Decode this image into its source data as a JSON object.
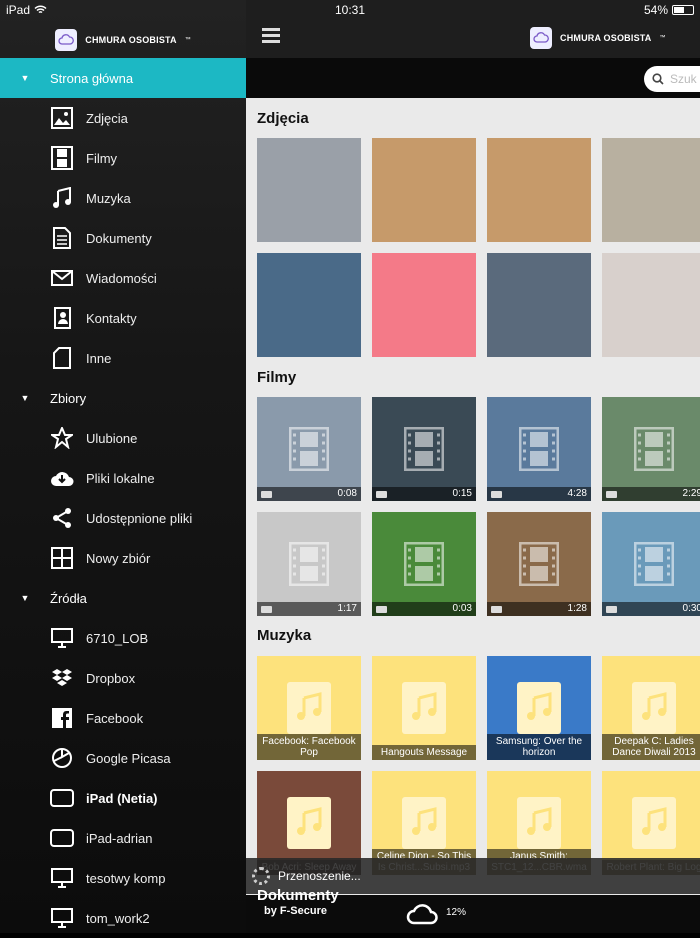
{
  "status": {
    "device": "iPad",
    "time": "10:31",
    "battery": "54%"
  },
  "app": {
    "logo_text": "CHMURA OSOBISTA",
    "tm": "™",
    "search_placeholder": "Szuk",
    "by": "by F-Secure",
    "upload_pct": "12%",
    "transfer_text": "Przenoszenie..."
  },
  "sidebar": {
    "sections": [
      {
        "label": "Strona główna"
      },
      {
        "label": "Zbiory"
      },
      {
        "label": "Źródła"
      }
    ],
    "home_items": [
      {
        "label": "Zdjęcia",
        "icon": "photo-icon"
      },
      {
        "label": "Filmy",
        "icon": "film-icon"
      },
      {
        "label": "Muzyka",
        "icon": "music-icon"
      },
      {
        "label": "Dokumenty",
        "icon": "document-icon"
      },
      {
        "label": "Wiadomości",
        "icon": "mail-icon"
      },
      {
        "label": "Kontakty",
        "icon": "contacts-icon"
      },
      {
        "label": "Inne",
        "icon": "file-icon"
      }
    ],
    "collections": [
      {
        "label": "Ulubione",
        "icon": "star-icon"
      },
      {
        "label": "Pliki lokalne",
        "icon": "download-cloud-icon"
      },
      {
        "label": "Udostępnione pliki",
        "icon": "share-icon"
      },
      {
        "label": "Nowy zbiór",
        "icon": "grid-icon"
      }
    ],
    "sources": [
      {
        "label": "6710_LOB",
        "icon": "monitor-icon"
      },
      {
        "label": "Dropbox",
        "icon": "dropbox-icon"
      },
      {
        "label": "Facebook",
        "icon": "facebook-icon"
      },
      {
        "label": "Google Picasa",
        "icon": "picasa-icon"
      },
      {
        "label": "iPad (Netia)",
        "icon": "tablet-icon"
      },
      {
        "label": "iPad-adrian",
        "icon": "tablet-icon"
      },
      {
        "label": "tesotwy komp",
        "icon": "monitor-icon"
      },
      {
        "label": "tom_work2",
        "icon": "monitor-icon"
      }
    ]
  },
  "main": {
    "sections": {
      "photos": "Zdjęcia",
      "videos": "Filmy",
      "music": "Muzyka",
      "docs": "Dokumenty"
    },
    "videos": [
      {
        "dur": "0:08",
        "color": "#8a9aab"
      },
      {
        "dur": "0:15",
        "color": "#3a4a55"
      },
      {
        "dur": "4:28",
        "color": "#5a7a9c"
      },
      {
        "dur": "2:29",
        "color": "#6a8a6a"
      },
      {
        "dur": "1:17",
        "color": "#c8c8c8"
      },
      {
        "dur": "0:03",
        "color": "#4a8a3a"
      },
      {
        "dur": "1:28",
        "color": "#8a6a4a"
      },
      {
        "dur": "0:30",
        "color": "#6a9aba"
      }
    ],
    "photos": [
      {
        "color": "#9aa0a8"
      },
      {
        "color": "#c69a6a"
      },
      {
        "color": "#c69a6a"
      },
      {
        "color": "#b8b0a0"
      },
      {
        "color": "#4a6a88"
      },
      {
        "color": "#f47a88"
      },
      {
        "color": "#5a6a7c"
      },
      {
        "color": "#d8d0cc"
      }
    ],
    "music": [
      {
        "caption": "Facebook: Facebook Pop",
        "color": "#fde27c"
      },
      {
        "caption": "Hangouts Message",
        "color": "#fde27c"
      },
      {
        "caption": "Samsung: Over the horizon",
        "color": "#3a7ac8"
      },
      {
        "caption": "Deepak C: Ladies Dance Diwali 2013",
        "color": "#fde27c"
      },
      {
        "caption": "Bob Acri: Sleep Away",
        "color": "#7a4a3a"
      },
      {
        "caption": "Celine Dion - So This Is Christ...Subsi.mp3",
        "color": "#fde27c"
      },
      {
        "caption": "Janus Smith: STC1_12...CBR.wma",
        "color": "#fde27c"
      },
      {
        "caption": "Robert Plant: Big Log",
        "color": "#fde27c"
      }
    ]
  }
}
